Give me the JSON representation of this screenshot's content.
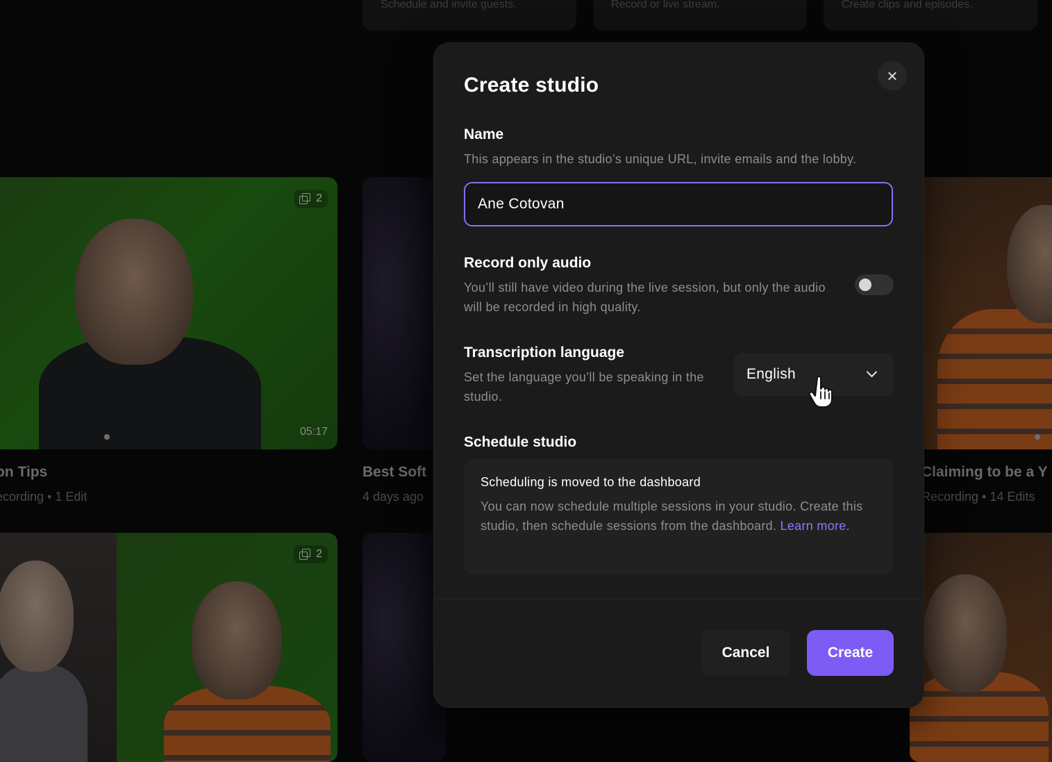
{
  "background": {
    "top_cards": [
      {
        "text": "Schedule and invite guests."
      },
      {
        "text": "Record or live stream."
      },
      {
        "text": "Create clips and episodes."
      }
    ],
    "recordings": [
      {
        "title": "on Tips",
        "meta": "ecording • 1 Edit",
        "edits": "2",
        "duration": "05:17"
      },
      {
        "title": "Best Soft",
        "meta": "4 days ago"
      },
      {
        "title": "Claiming to be a Y",
        "meta": "Recording • 14 Edits"
      },
      {
        "edits": "2"
      }
    ]
  },
  "modal": {
    "title": "Create studio",
    "name_section": {
      "label": "Name",
      "description": "This appears in the studio’s unique URL, invite emails and the lobby.",
      "value": "Ane Cotovan"
    },
    "audio_section": {
      "label": "Record only audio",
      "description": "You’ll still have video during the live session, but only the audio will be recorded in high quality.",
      "enabled": false
    },
    "language_section": {
      "label": "Transcription language",
      "description": "Set the language you’ll be speaking in the studio.",
      "selected": "English"
    },
    "schedule_section": {
      "label": "Schedule studio",
      "info_title": "Scheduling is moved to the dashboard",
      "info_text": "You can now schedule multiple sessions in your studio. Create this studio, then schedule sessions from the dashboard.",
      "link_text": "Learn more."
    },
    "buttons": {
      "cancel": "Cancel",
      "create": "Create"
    }
  },
  "colors": {
    "accent": "#7c5cf5",
    "link": "#8f75ff",
    "modal_bg": "#1b1b1b"
  }
}
